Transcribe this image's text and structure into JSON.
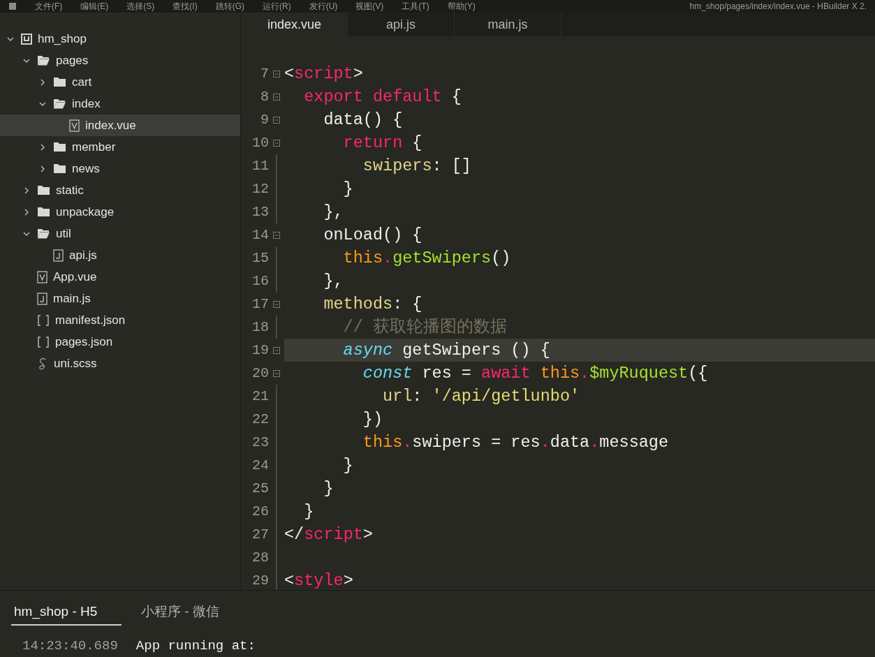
{
  "menu_bar": {
    "items": [
      "文件(F)",
      "编辑(E)",
      "选择(S)",
      "查找(I)",
      "跳转(G)",
      "运行(R)",
      "发行(U)",
      "视图(V)",
      "工具(T)",
      "帮助(Y)"
    ],
    "title": "hm_shop/pages/index/index.vue - HBuilder X 2."
  },
  "project_tree": [
    {
      "name": "hm_shop",
      "kind": "project",
      "expanded": true,
      "selected": false,
      "children": [
        {
          "name": "pages",
          "kind": "folder",
          "expanded": true,
          "selected": false,
          "children": [
            {
              "name": "cart",
              "kind": "folder",
              "expanded": false,
              "selected": false
            },
            {
              "name": "index",
              "kind": "folder",
              "expanded": true,
              "selected": false,
              "children": [
                {
                  "name": "index.vue",
                  "kind": "vue",
                  "selected": true
                }
              ]
            },
            {
              "name": "member",
              "kind": "folder",
              "expanded": false,
              "selected": false
            },
            {
              "name": "news",
              "kind": "folder",
              "expanded": false,
              "selected": false
            }
          ]
        },
        {
          "name": "static",
          "kind": "folder",
          "expanded": false,
          "selected": false
        },
        {
          "name": "unpackage",
          "kind": "folder",
          "expanded": false,
          "selected": false
        },
        {
          "name": "util",
          "kind": "folder",
          "expanded": true,
          "selected": false,
          "children": [
            {
              "name": "api.js",
              "kind": "js",
              "selected": false
            }
          ]
        },
        {
          "name": "App.vue",
          "kind": "vue",
          "selected": false
        },
        {
          "name": "main.js",
          "kind": "js",
          "selected": false
        },
        {
          "name": "manifest.json",
          "kind": "json",
          "selected": false
        },
        {
          "name": "pages.json",
          "kind": "json",
          "selected": false
        },
        {
          "name": "uni.scss",
          "kind": "scss",
          "selected": false
        }
      ]
    }
  ],
  "editor_tabs": [
    {
      "label": "index.vue",
      "selected": true
    },
    {
      "label": "api.js",
      "selected": false
    },
    {
      "label": "main.js",
      "selected": false
    }
  ],
  "code_lines": [
    {
      "number": "7",
      "fold": true,
      "current": false,
      "tokens": [
        {
          "text": "<",
          "kind": "plain"
        },
        {
          "text": "script",
          "kind": "tag"
        },
        {
          "text": ">",
          "kind": "plain"
        }
      ]
    },
    {
      "number": "8",
      "fold": true,
      "current": false,
      "tokens": [
        {
          "text": "  export default",
          "kind": "keyword"
        },
        {
          "text": " {",
          "kind": "plain"
        }
      ]
    },
    {
      "number": "9",
      "fold": true,
      "current": false,
      "tokens": [
        {
          "text": "    data() {",
          "kind": "plain"
        }
      ]
    },
    {
      "number": "10",
      "fold": true,
      "current": false,
      "tokens": [
        {
          "text": "      return",
          "kind": "keyword"
        },
        {
          "text": " {",
          "kind": "plain"
        }
      ]
    },
    {
      "number": "11",
      "fold": false,
      "current": false,
      "tokens": [
        {
          "text": "        swipers",
          "kind": "property"
        },
        {
          "text": ": []",
          "kind": "plain"
        }
      ]
    },
    {
      "number": "12",
      "fold": false,
      "current": false,
      "tokens": [
        {
          "text": "      }",
          "kind": "plain"
        }
      ]
    },
    {
      "number": "13",
      "fold": false,
      "current": false,
      "tokens": [
        {
          "text": "    },",
          "kind": "plain"
        }
      ]
    },
    {
      "number": "14",
      "fold": true,
      "current": false,
      "tokens": [
        {
          "text": "    onLoad() {",
          "kind": "plain"
        }
      ]
    },
    {
      "number": "15",
      "fold": false,
      "current": false,
      "tokens": [
        {
          "text": "      this",
          "kind": "this"
        },
        {
          "text": ".",
          "kind": "punct"
        },
        {
          "text": "getSwipers",
          "kind": "function"
        },
        {
          "text": "()",
          "kind": "plain"
        }
      ]
    },
    {
      "number": "16",
      "fold": false,
      "current": false,
      "tokens": [
        {
          "text": "    },",
          "kind": "plain"
        }
      ]
    },
    {
      "number": "17",
      "fold": true,
      "current": false,
      "tokens": [
        {
          "text": "    methods",
          "kind": "property"
        },
        {
          "text": ": {",
          "kind": "plain"
        }
      ]
    },
    {
      "number": "18",
      "fold": false,
      "current": false,
      "tokens": [
        {
          "text": "      // 获取轮播图的数据",
          "kind": "comment"
        }
      ]
    },
    {
      "number": "19",
      "fold": true,
      "current": true,
      "tokens": [
        {
          "text": "      async",
          "kind": "storage"
        },
        {
          "text": " getSwipers () {",
          "kind": "plain"
        }
      ]
    },
    {
      "number": "20",
      "fold": true,
      "current": false,
      "tokens": [
        {
          "text": "        const",
          "kind": "storage"
        },
        {
          "text": " res = ",
          "kind": "plain"
        },
        {
          "text": "await",
          "kind": "keyword"
        },
        {
          "text": " this",
          "kind": "this"
        },
        {
          "text": ".",
          "kind": "punct"
        },
        {
          "text": "$myRuquest",
          "kind": "function"
        },
        {
          "text": "({",
          "kind": "plain"
        }
      ]
    },
    {
      "number": "21",
      "fold": false,
      "current": false,
      "tokens": [
        {
          "text": "          url",
          "kind": "property"
        },
        {
          "text": ": ",
          "kind": "plain"
        },
        {
          "text": "'/api/getlunbo'",
          "kind": "string"
        }
      ]
    },
    {
      "number": "22",
      "fold": false,
      "current": false,
      "tokens": [
        {
          "text": "        })",
          "kind": "plain"
        }
      ]
    },
    {
      "number": "23",
      "fold": false,
      "current": false,
      "tokens": [
        {
          "text": "        this",
          "kind": "this"
        },
        {
          "text": ".",
          "kind": "punct"
        },
        {
          "text": "swipers = res",
          "kind": "plain"
        },
        {
          "text": ".",
          "kind": "punct"
        },
        {
          "text": "data",
          "kind": "plain"
        },
        {
          "text": ".",
          "kind": "punct"
        },
        {
          "text": "message",
          "kind": "plain"
        }
      ]
    },
    {
      "number": "24",
      "fold": false,
      "current": false,
      "tokens": [
        {
          "text": "      }",
          "kind": "plain"
        }
      ]
    },
    {
      "number": "25",
      "fold": false,
      "current": false,
      "tokens": [
        {
          "text": "    }",
          "kind": "plain"
        }
      ]
    },
    {
      "number": "26",
      "fold": false,
      "current": false,
      "tokens": [
        {
          "text": "  }",
          "kind": "plain"
        }
      ]
    },
    {
      "number": "27",
      "fold": false,
      "current": false,
      "tokens": [
        {
          "text": "</",
          "kind": "plain"
        },
        {
          "text": "script",
          "kind": "tag"
        },
        {
          "text": ">",
          "kind": "plain"
        }
      ]
    },
    {
      "number": "28",
      "fold": false,
      "current": false
    },
    {
      "number": "29",
      "fold": false,
      "current": false,
      "tokens": [
        {
          "text": "<",
          "kind": "plain"
        },
        {
          "text": "style",
          "kind": "tag"
        },
        {
          "text": ">",
          "kind": "plain"
        }
      ]
    }
  ],
  "console_tabs": [
    {
      "label": "hm_shop - H5",
      "selected": true
    },
    {
      "label": "小程序 - 微信",
      "selected": false
    }
  ],
  "console_log": [
    {
      "time": "14:23:40.689",
      "message": "App running at:"
    }
  ]
}
